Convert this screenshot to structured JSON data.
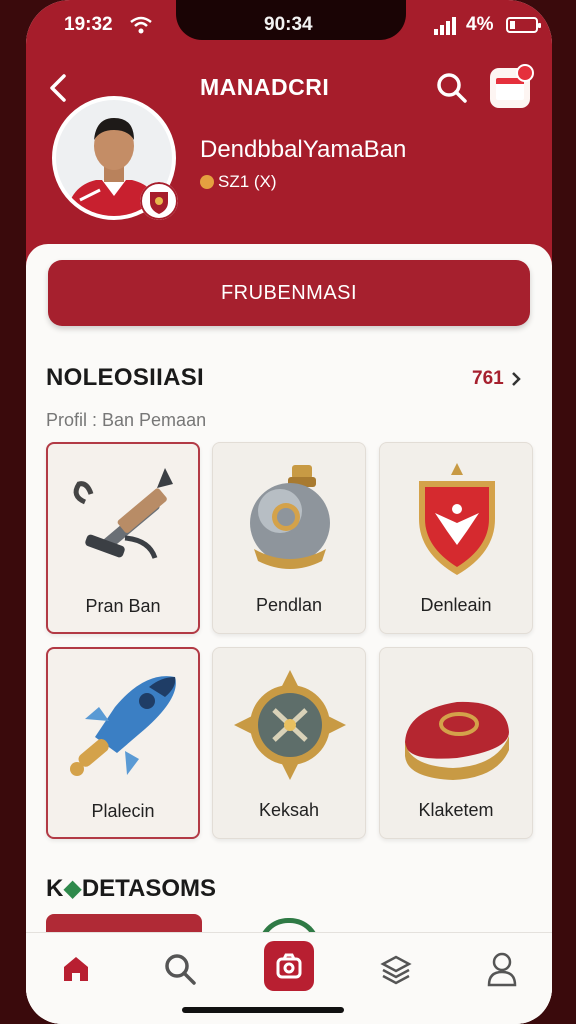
{
  "status_bar": {
    "time": "19:32",
    "clock": "90:34",
    "battery": "4%"
  },
  "header": {
    "title": "MANADCRI",
    "name": "DendbbalYamaBan",
    "meta": "SZ1 (X)"
  },
  "primary_button": {
    "label": "FRUBENMASI"
  },
  "section": {
    "title": "NOLEOSIIASI",
    "count": "761",
    "subtitle": "Profil : Ban Pemaan"
  },
  "items": [
    {
      "label": "Pran Ban",
      "icon": "wrench-arrow-icon"
    },
    {
      "label": "Pendlan",
      "icon": "flask-icon"
    },
    {
      "label": "Denleain",
      "icon": "eagle-shield-icon"
    },
    {
      "label": "Plalecin",
      "icon": "rocket-icon"
    },
    {
      "label": "Keksah",
      "icon": "compass-emblem-icon"
    },
    {
      "label": "Klaketem",
      "icon": "red-hat-icon"
    }
  ],
  "section2": {
    "lead": "K",
    "drop": "◆",
    "title": "DETASOMS"
  },
  "nav": [
    "home-icon",
    "search-icon",
    "camera-icon",
    "layers-icon",
    "profile-icon"
  ],
  "colors": {
    "brand": "#a61d2b",
    "accent": "#b81f31",
    "bg": "#fbfaf8"
  }
}
